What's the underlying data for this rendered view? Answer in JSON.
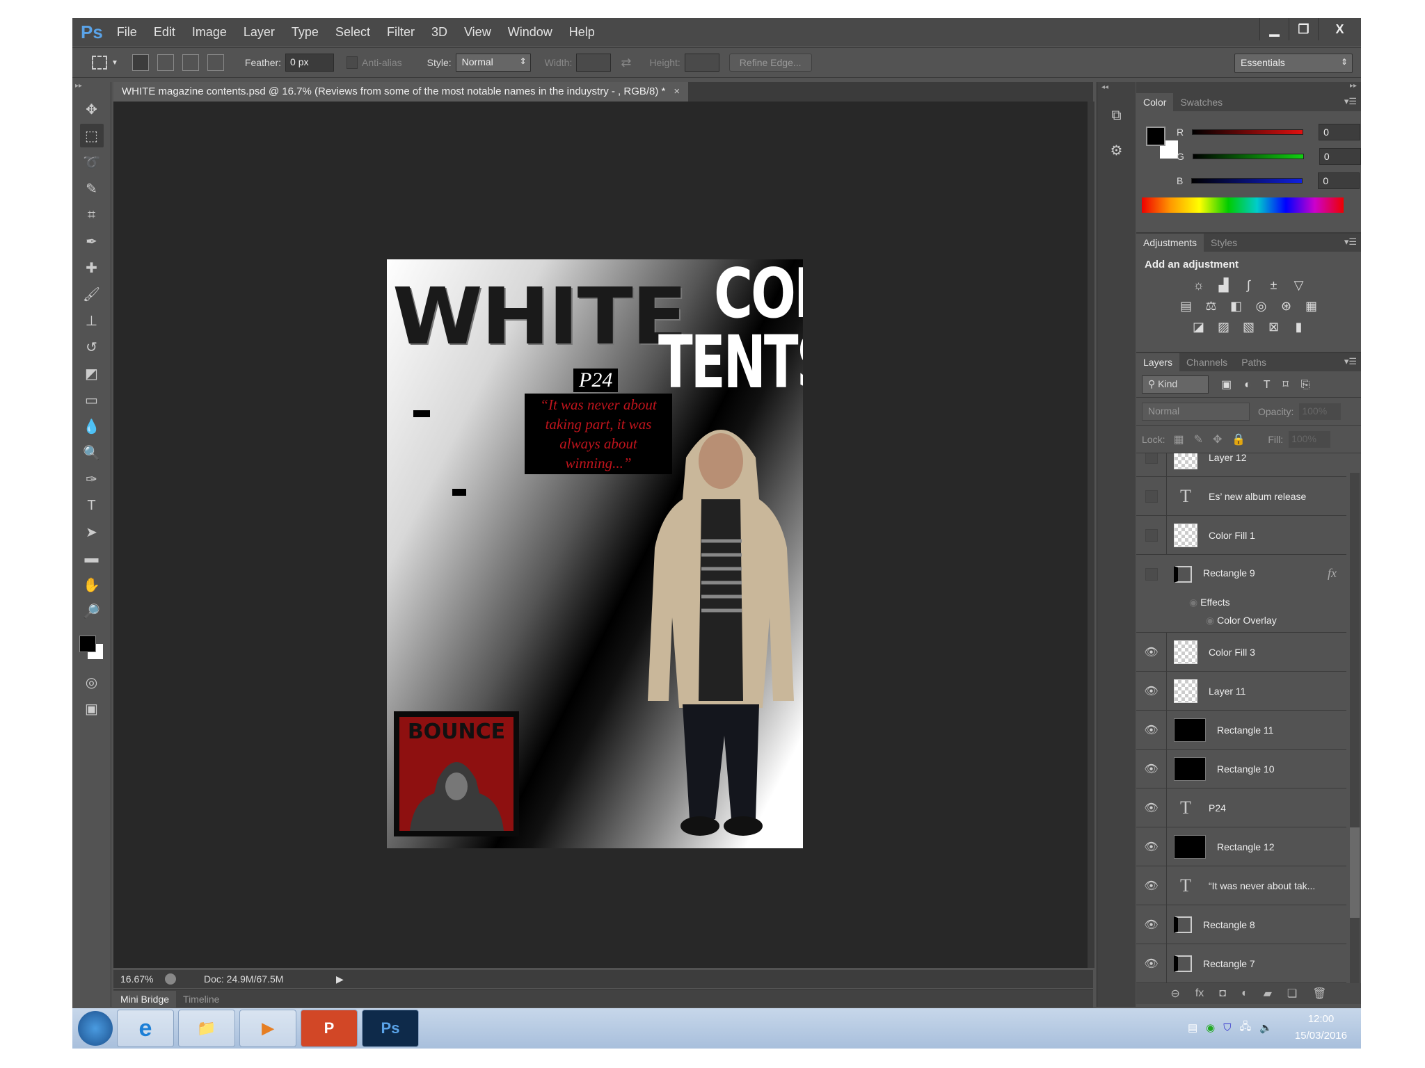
{
  "app": {
    "logo": "Ps",
    "menu": [
      "File",
      "Edit",
      "Image",
      "Layer",
      "Type",
      "Select",
      "Filter",
      "3D",
      "View",
      "Window",
      "Help"
    ],
    "window_controls": {
      "minimize": "▁",
      "restore": "❐",
      "close": "X"
    }
  },
  "options": {
    "feather_label": "Feather:",
    "feather_value": "0 px",
    "antialias_label": "Anti-alias",
    "style_label": "Style:",
    "style_value": "Normal",
    "width_label": "Width:",
    "height_label": "Height:",
    "refine_edge": "Refine Edge...",
    "workspace": "Essentials"
  },
  "document": {
    "tab_title": "WHITE magazine contents.psd @ 16.7% (Reviews from some of the most notable names in the induystry - , RGB/8) *",
    "close": "×",
    "artwork": {
      "title": "WHITE",
      "con": "CON",
      "tents": "TENTS",
      "page": "P24",
      "quote": "“It was never about taking part, it was always about winning...”",
      "bounce": "BOUNCE"
    }
  },
  "status": {
    "zoom": "16.67%",
    "doc": "Doc: 24.9M/67.5M"
  },
  "bottom_tabs": [
    "Mini Bridge",
    "Timeline"
  ],
  "color_panel": {
    "tabs": [
      "Color",
      "Swatches"
    ],
    "channels": [
      {
        "label": "R",
        "value": "0",
        "color": "#e01010"
      },
      {
        "label": "G",
        "value": "0",
        "color": "#10d010"
      },
      {
        "label": "B",
        "value": "0",
        "color": "#1020e0"
      }
    ]
  },
  "adjustments_panel": {
    "tabs": [
      "Adjustments",
      "Styles"
    ],
    "heading": "Add an adjustment"
  },
  "layers_panel": {
    "tabs": [
      "Layers",
      "Channels",
      "Paths"
    ],
    "filter": "Kind",
    "blend_mode": "Normal",
    "opacity_label": "Opacity:",
    "opacity_value": "100%",
    "lock_label": "Lock:",
    "fill_label": "Fill:",
    "fill_value": "100%",
    "effects_label": "Effects",
    "color_overlay_label": "Color Overlay",
    "fx": "fx",
    "layers": [
      {
        "name": "Layer 12",
        "type": "pixel",
        "visible": false
      },
      {
        "name": "Es’ new album release",
        "type": "text",
        "visible": false
      },
      {
        "name": "Color Fill 1",
        "type": "pixel",
        "visible": false
      },
      {
        "name": "Rectangle 9",
        "type": "shape",
        "visible": false,
        "fx": true
      },
      {
        "name": "Color Fill 3",
        "type": "pixel",
        "visible": true
      },
      {
        "name": "Layer 11",
        "type": "pixel",
        "visible": true
      },
      {
        "name": "Rectangle 11",
        "type": "shape-black",
        "visible": true
      },
      {
        "name": "Rectangle 10",
        "type": "shape-black",
        "visible": true
      },
      {
        "name": "P24",
        "type": "text",
        "visible": true
      },
      {
        "name": "Rectangle 12",
        "type": "shape-black",
        "visible": true
      },
      {
        "name": "“It was never about tak...",
        "type": "text",
        "visible": true
      },
      {
        "name": "Rectangle 8",
        "type": "shape",
        "visible": true
      },
      {
        "name": "Rectangle 7",
        "type": "shape",
        "visible": true
      }
    ]
  },
  "taskbar": {
    "apps": [
      "e",
      "📁",
      "▶",
      "P",
      "Ps"
    ],
    "time": "12:00",
    "date": "15/03/2016"
  }
}
